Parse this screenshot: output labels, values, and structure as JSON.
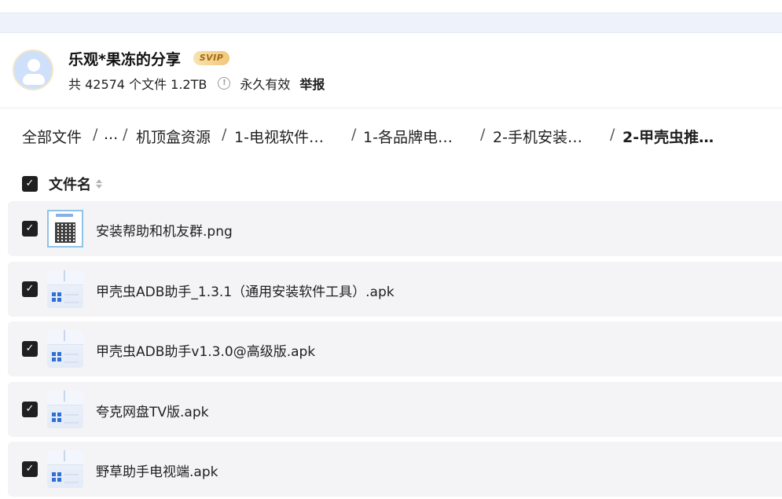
{
  "share": {
    "owner_name": "乐观*果冻的分享",
    "badge": "SVIP",
    "file_count_text": "共 42574 个文件 1.2TB",
    "info_icon": "info-circle-icon",
    "validity": "永久有效",
    "report": "举报"
  },
  "breadcrumb": {
    "items": [
      "全部文件",
      "...",
      "机顶盒资源",
      "1-电视软件…",
      "1-各品牌电…",
      "2-手机安装…",
      "2-甲壳虫推…"
    ],
    "separator": "/"
  },
  "list": {
    "header_label": "文件名",
    "header_checked": true,
    "check_mark": "✓",
    "files": [
      {
        "name": "安装帮助和机友群.png",
        "icon": "qr-image-icon",
        "checked": true
      },
      {
        "name": "甲壳虫ADB助手_1.3.1（通用安装软件工具）.apk",
        "icon": "apk-file-icon",
        "checked": true
      },
      {
        "name": "甲壳虫ADB助手v1.3.0@高级版.apk",
        "icon": "apk-file-icon",
        "checked": true
      },
      {
        "name": "夸克网盘TV版.apk",
        "icon": "apk-file-icon",
        "checked": true
      },
      {
        "name": "野草助手电视端.apk",
        "icon": "apk-file-icon",
        "checked": true
      }
    ]
  },
  "colors": {
    "row_bg": "#f4f4f6",
    "checkbox": "#1f1f1f",
    "svip_gold": "#f1c77a",
    "strip_bg": "#eef2fb"
  }
}
